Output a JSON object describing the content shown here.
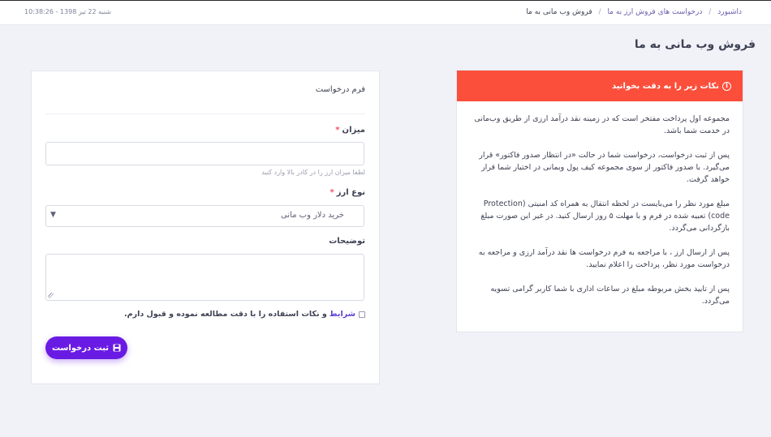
{
  "header": {
    "breadcrumb": {
      "home": "داشبورد",
      "parent": "درخواست های فروش ارز به ما",
      "current": "فروش وب مانی به ما",
      "separator": "/"
    },
    "datetime": "شنبه 22 تیر 1398 - 10:38:26"
  },
  "page": {
    "title": "فروش وب مانی به ما"
  },
  "notice": {
    "header": "نکات زیر را به دقت بخوانید",
    "icon": "info-icon",
    "paragraphs": [
      "مجموعه اول پرداخت مفتخر است که در زمینه نقد درآمد ارزی از طریق وب‌مانی در خدمت شما باشد.",
      "پس از ثبت درخواست، درخواست شما در حالت «در انتظار صدور فاکتور» قرار می‌گیرد. با صدور فاکتور از سوی مجموعه کیف پول وبمانی در اختیار شما قرار خواهد گرفت.",
      "مبلغ مورد نظر را می‌بایست در لحظه انتقال به همراه کد امنیتی (Protection code) تعبیه شده در فرم و با مهلت ۵ روز ارسال کنید. در غیر این صورت مبلغ بازگردانی می‌گردد.",
      "پس از ارسال ارز ، با مراجعه به فرم درخواست ها نقد درآمد ارزی و مراجعه به درخواست مورد نظر، پرداخت را اعلام نمایید.",
      "پس از تایید بخش مربوطه مبلغ در ساعات اداری با شما کاربر گرامی تسویه می‌گردد."
    ],
    "header_color": "#fb4f3b"
  },
  "form": {
    "title": "فرم درخواست",
    "amount": {
      "label": "میزان",
      "required": "*",
      "value": "",
      "hint": "لطفا میزان ارز را در کادر بالا وارد کنید"
    },
    "currency": {
      "label": "نوع ارز",
      "required": "*",
      "selected": "خرید دلار وب مانی",
      "caret": "▼"
    },
    "description": {
      "label": "توضیحات",
      "value": ""
    },
    "terms": {
      "link": "شرایط",
      "text": "و نکات استفاده را با دقت مطالعه نموده و قبول دارم.",
      "checked": false
    },
    "submit": {
      "label": "ثبت درخواست",
      "icon": "save-icon"
    },
    "accent_color": "#6a1be3"
  }
}
